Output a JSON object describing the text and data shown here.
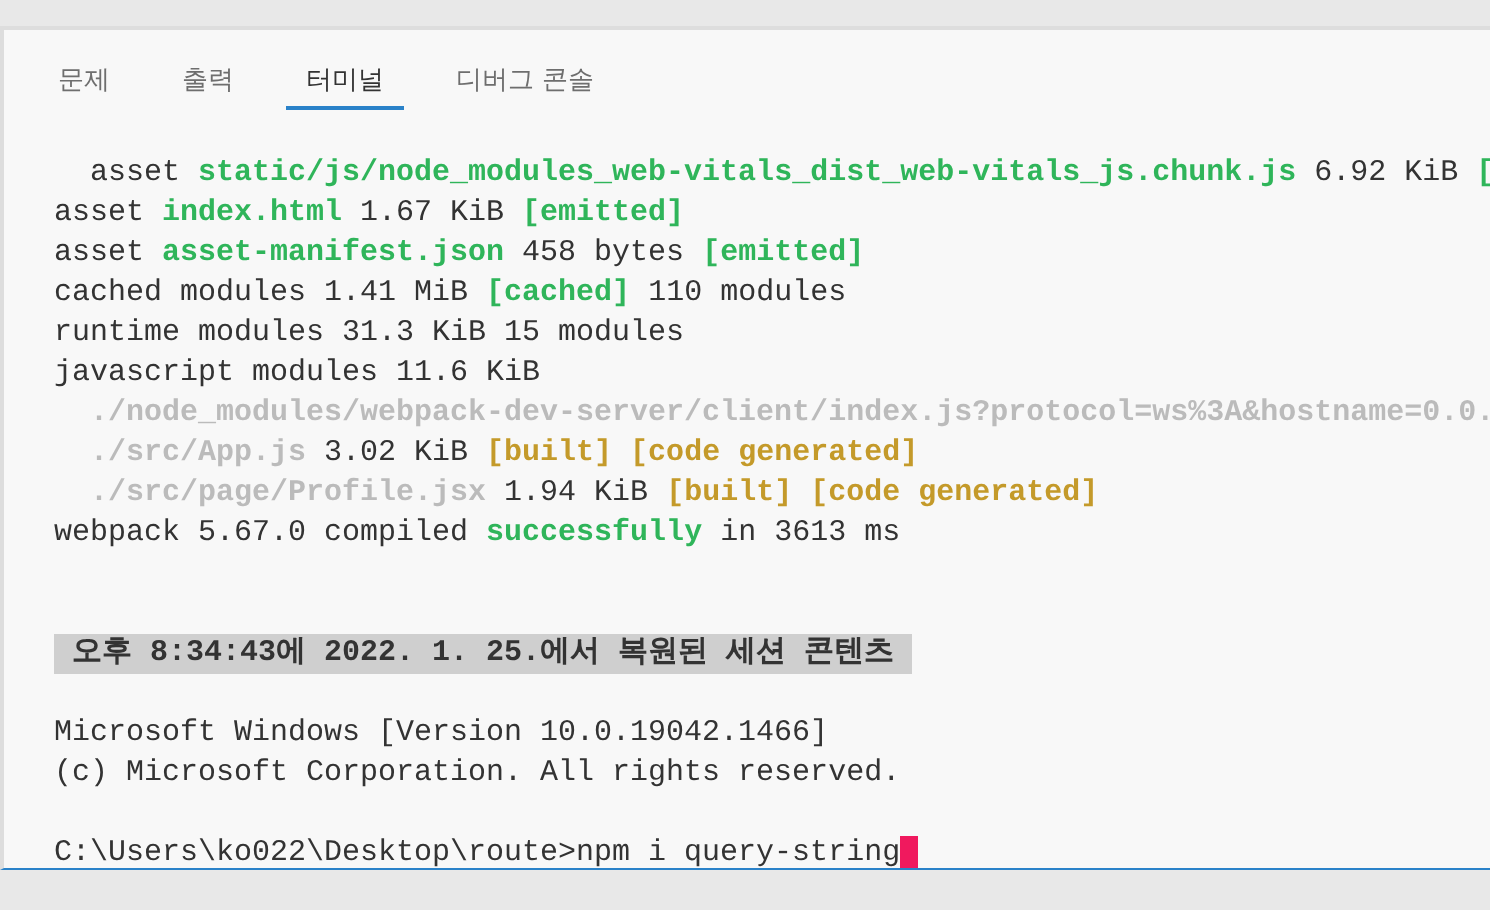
{
  "tabs": [
    {
      "label": "문제",
      "selected": false
    },
    {
      "label": "출력",
      "selected": false
    },
    {
      "label": "터미널",
      "selected": true
    },
    {
      "label": "디버그 콘솔",
      "selected": false
    }
  ],
  "terminal": {
    "lines": [
      {
        "kind": "output",
        "segments": [
          {
            "kind": "plain",
            "text": "  asset "
          },
          {
            "kind": "green",
            "text": "static/js/node_modules_web-vitals_dist_web-vitals_js.chunk.js"
          },
          {
            "kind": "plain",
            "text": " 6.92 KiB "
          },
          {
            "kind": "green",
            "text": "["
          }
        ]
      },
      {
        "kind": "output",
        "segments": [
          {
            "kind": "plain",
            "text": "asset "
          },
          {
            "kind": "green",
            "text": "index.html"
          },
          {
            "kind": "plain",
            "text": " 1.67 KiB "
          },
          {
            "kind": "green",
            "text": "[emitted]"
          }
        ]
      },
      {
        "kind": "output",
        "segments": [
          {
            "kind": "plain",
            "text": "asset "
          },
          {
            "kind": "green",
            "text": "asset-manifest.json"
          },
          {
            "kind": "plain",
            "text": " 458 bytes "
          },
          {
            "kind": "green",
            "text": "[emitted]"
          }
        ]
      },
      {
        "kind": "output",
        "segments": [
          {
            "kind": "plain",
            "text": "cached modules 1.41 MiB "
          },
          {
            "kind": "green",
            "text": "[cached]"
          },
          {
            "kind": "plain",
            "text": " 110 modules"
          }
        ]
      },
      {
        "kind": "output",
        "segments": [
          {
            "kind": "plain",
            "text": "runtime modules 31.3 KiB 15 modules"
          }
        ]
      },
      {
        "kind": "output",
        "segments": [
          {
            "kind": "plain",
            "text": "javascript modules 11.6 KiB"
          }
        ]
      },
      {
        "kind": "output",
        "segments": [
          {
            "kind": "dim",
            "text": "  ./node_modules/webpack-dev-server/client/index.js?protocol=ws%3A&hostname=0.0."
          }
        ]
      },
      {
        "kind": "output",
        "segments": [
          {
            "kind": "dim",
            "text": "  ./src/App.js"
          },
          {
            "kind": "plain",
            "text": " 3.02 KiB "
          },
          {
            "kind": "yellow",
            "text": "[built] [code generated]"
          }
        ]
      },
      {
        "kind": "output",
        "segments": [
          {
            "kind": "dim",
            "text": "  ./src/page/Profile.jsx"
          },
          {
            "kind": "plain",
            "text": " 1.94 KiB "
          },
          {
            "kind": "yellow",
            "text": "[built] [code generated]"
          }
        ]
      },
      {
        "kind": "output",
        "segments": [
          {
            "kind": "plain",
            "text": "webpack 5.67.0 compiled "
          },
          {
            "kind": "green",
            "text": "successfully"
          },
          {
            "kind": "plain",
            "text": " in 3613 ms"
          }
        ]
      },
      {
        "kind": "blank"
      },
      {
        "kind": "blank"
      },
      {
        "kind": "banner",
        "segments": [
          {
            "kind": "plain",
            "text": " 오후 8:34:43에 2022. 1. 25.에서 복원된 세션 콘텐츠 "
          }
        ]
      },
      {
        "kind": "blank"
      },
      {
        "kind": "output",
        "segments": [
          {
            "kind": "plain",
            "text": "Microsoft Windows [Version 10.0.19042.1466]"
          }
        ]
      },
      {
        "kind": "output",
        "segments": [
          {
            "kind": "plain",
            "text": "(c) Microsoft Corporation. All rights reserved."
          }
        ]
      },
      {
        "kind": "blank"
      },
      {
        "kind": "prompt",
        "cursor": true,
        "segments": [
          {
            "kind": "plain",
            "text": "C:\\Users\\ko022\\Desktop\\route>npm i query-string"
          }
        ]
      }
    ]
  }
}
